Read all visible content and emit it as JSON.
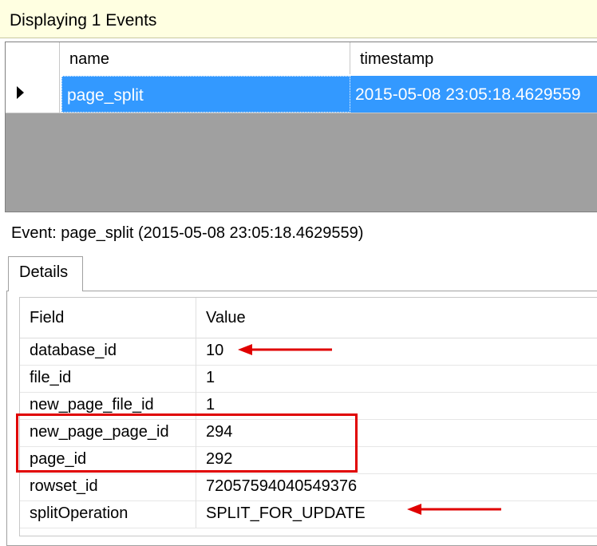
{
  "banner": {
    "text": "Displaying 1 Events"
  },
  "grid": {
    "columns": [
      "name",
      "timestamp"
    ],
    "rows": [
      {
        "name": "page_split",
        "timestamp": "2015-05-08 23:05:18.4629559"
      }
    ]
  },
  "event": {
    "title": "Event: page_split (2015-05-08 23:05:18.4629559)"
  },
  "tabs": [
    {
      "label": "Details"
    }
  ],
  "details": {
    "headers": {
      "field": "Field",
      "value": "Value"
    },
    "rows": [
      {
        "field": "database_id",
        "value": "10"
      },
      {
        "field": "file_id",
        "value": "1"
      },
      {
        "field": "new_page_file_id",
        "value": "1"
      },
      {
        "field": "new_page_page_id",
        "value": "294"
      },
      {
        "field": "page_id",
        "value": "292"
      },
      {
        "field": "rowset_id",
        "value": "72057594040549376"
      },
      {
        "field": "splitOperation",
        "value": "SPLIT_FOR_UPDATE"
      }
    ]
  },
  "colors": {
    "selection": "#3399ff",
    "annotation": "#e00000",
    "banner": "#ffffe1"
  }
}
